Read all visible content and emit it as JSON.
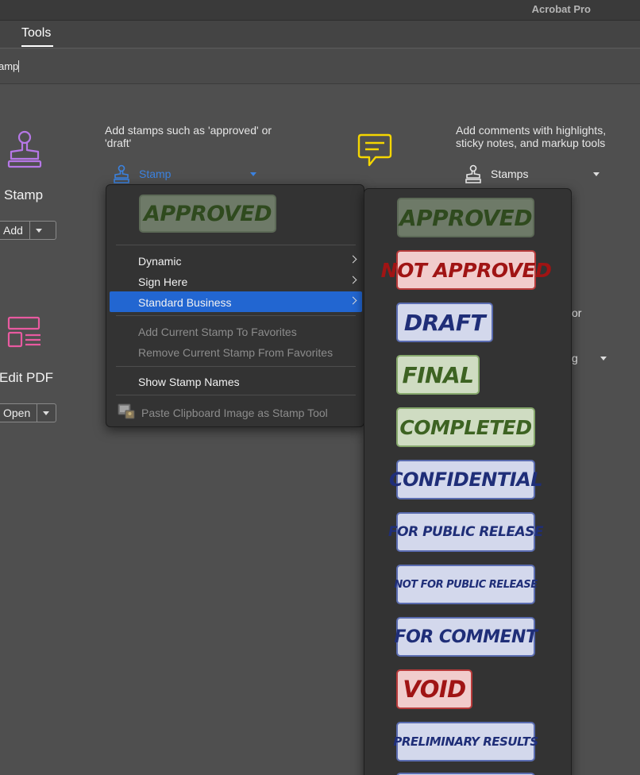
{
  "app": {
    "title": "Acrobat Pro"
  },
  "tabs": {
    "tools": "Tools"
  },
  "search": {
    "value": "amp"
  },
  "tools_left": {
    "stamp": {
      "name": "Stamp",
      "button": "Add"
    },
    "edit_pdf": {
      "name": "Edit PDF",
      "button": "Open"
    }
  },
  "stamp_tool": {
    "description": "Add stamps such as 'approved' or 'draft'",
    "dropdown_label": "Stamp"
  },
  "comment_tool": {
    "description": "Add comments with highlights, sticky notes, and markup tools",
    "dropdown_label": "Stamps",
    "partial_text_1": "or",
    "partial_text_2": "g"
  },
  "stamp_menu": {
    "preview_stamp": "APPROVED",
    "items": [
      {
        "label": "Dynamic",
        "submenu": true
      },
      {
        "label": "Sign Here",
        "submenu": true
      },
      {
        "label": "Standard Business",
        "submenu": true,
        "selected": true
      }
    ],
    "favorites": {
      "add": "Add Current Stamp To Favorites",
      "remove": "Remove Current Stamp From Favorites"
    },
    "show_names": "Show Stamp Names",
    "paste": "Paste Clipboard Image as Stamp Tool"
  },
  "standard_business_stamps": [
    "APPROVED",
    "NOT APPROVED",
    "DRAFT",
    "FINAL",
    "COMPLETED",
    "CONFIDENTIAL",
    "FOR PUBLIC RELEASE",
    "NOT FOR PUBLIC RELEASE",
    "FOR COMMENT",
    "VOID",
    "PRELIMINARY RESULTS"
  ],
  "colors": {
    "stamp_icon": "#b677e6",
    "edit_pdf_icon": "#e85aa0",
    "comment_icon": "#f5d600",
    "menu_selected": "#2266d1",
    "link_blue": "#3b82e0"
  }
}
